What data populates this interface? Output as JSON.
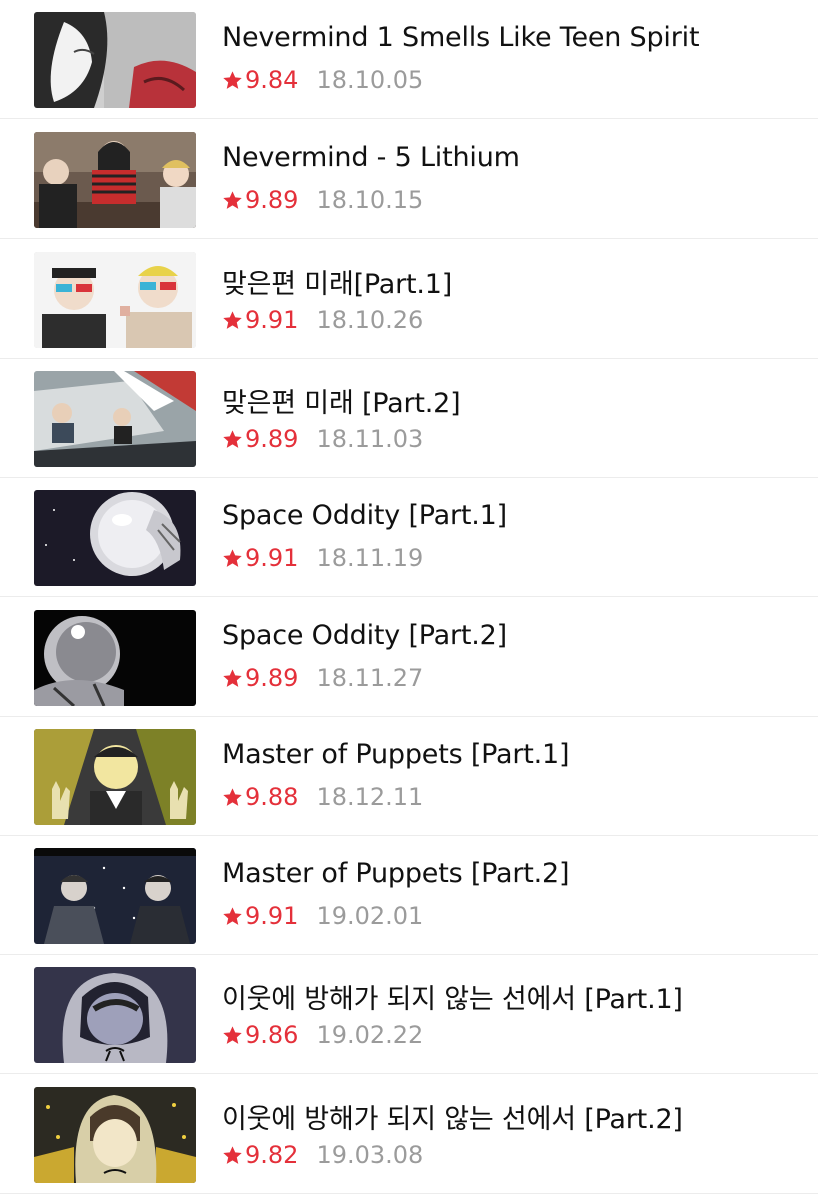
{
  "colors": {
    "rating": "#e4303a",
    "date": "#9b9b9b",
    "title": "#111111",
    "divider": "#ececec"
  },
  "episodes": [
    {
      "title": "Nevermind 1 Smells Like Teen Spirit",
      "rating": "9.84",
      "date": "18.10.05",
      "thumbnail": "woman-portrait-grey-red"
    },
    {
      "title": "Nevermind - 5 Lithium",
      "rating": "9.89",
      "date": "18.10.15",
      "thumbnail": "three-people-at-bar"
    },
    {
      "title": "맞은편 미래[Part.1]",
      "rating": "9.91",
      "date": "18.10.26",
      "thumbnail": "two-men-3d-glasses"
    },
    {
      "title": "맞은편 미래 [Part.2]",
      "rating": "9.89",
      "date": "18.11.03",
      "thumbnail": "people-in-car"
    },
    {
      "title": "Space Oddity [Part.1]",
      "rating": "9.91",
      "date": "18.11.19",
      "thumbnail": "astronaut-helmet-hand"
    },
    {
      "title": "Space Oddity [Part.2]",
      "rating": "9.89",
      "date": "18.11.27",
      "thumbnail": "astronaut-black-space"
    },
    {
      "title": "Master of Puppets [Part.1]",
      "rating": "9.88",
      "date": "18.12.11",
      "thumbnail": "man-rock-hands"
    },
    {
      "title": "Master of Puppets [Part.2]",
      "rating": "9.91",
      "date": "19.02.01",
      "thumbnail": "two-men-night-sky"
    },
    {
      "title": "이웃에 방해가 되지 않는 선에서 [Part.1]",
      "rating": "9.86",
      "date": "19.02.22",
      "thumbnail": "hooded-girl-dark"
    },
    {
      "title": "이웃에 방해가 되지 않는 선에서 [Part.2]",
      "rating": "9.82",
      "date": "19.03.08",
      "thumbnail": "hooded-girl-concert"
    }
  ],
  "icons": {
    "rating_star": "star-icon"
  }
}
